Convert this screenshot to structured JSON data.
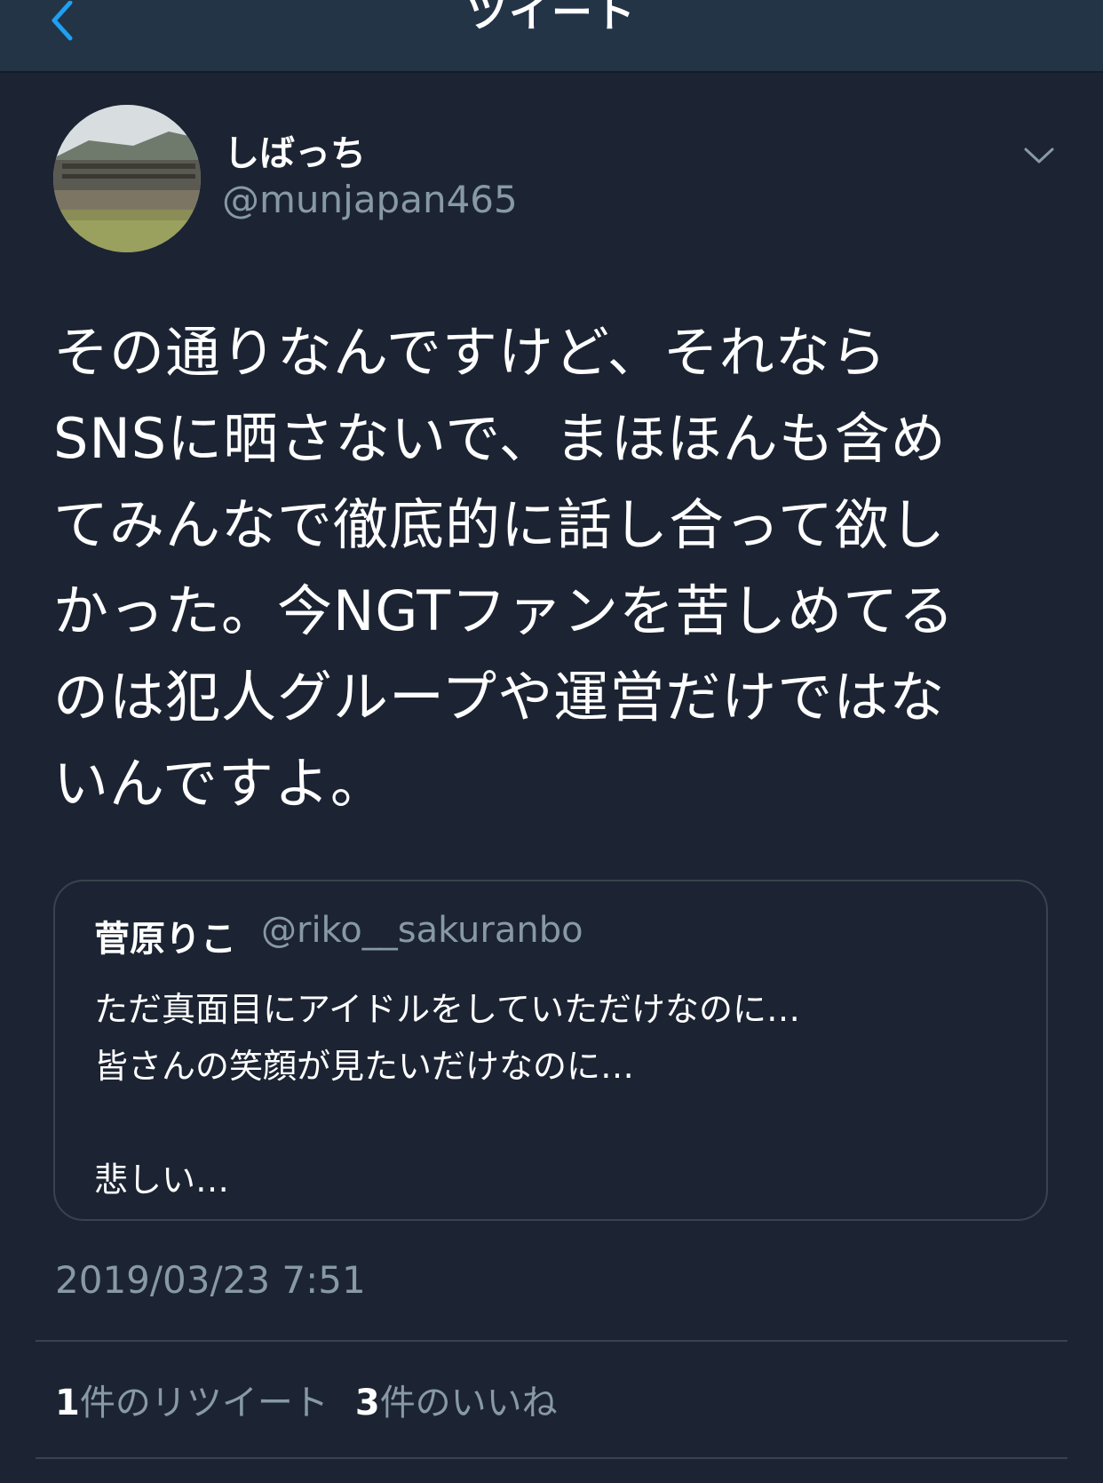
{
  "header": {
    "title": "ツイート"
  },
  "author": {
    "display_name": "しばっち",
    "username": "@munjapan465"
  },
  "tweet": {
    "text": "その通りなんですけど、それなら\nSNSに晒さないで、まほほんも含め\nてみんなで徹底的に話し合って欲し\nかった。今NGTファンを苦しめてる\nのは犯人グループや運営だけではな\nいんですよ。",
    "timestamp": "2019/03/23 7:51"
  },
  "quoted_tweet": {
    "display_name": "菅原りこ",
    "username": "@riko__sakuranbo",
    "text": "ただ真面目にアイドルをしていただけなのに…\n皆さんの笑顔が見たいだけなのに…\n\n悲しい…"
  },
  "stats": {
    "retweets_count": "1",
    "retweets_label": "件のリツイート",
    "likes_count": "3",
    "likes_label": "件のいいね"
  },
  "colors": {
    "background": "#1c2433",
    "navbar": "#243447",
    "accent": "#1da1f2",
    "secondary_text": "#8899a6",
    "border": "#38444d"
  },
  "icons": {
    "back": "chevron-left-icon",
    "more": "chevron-down-icon"
  }
}
